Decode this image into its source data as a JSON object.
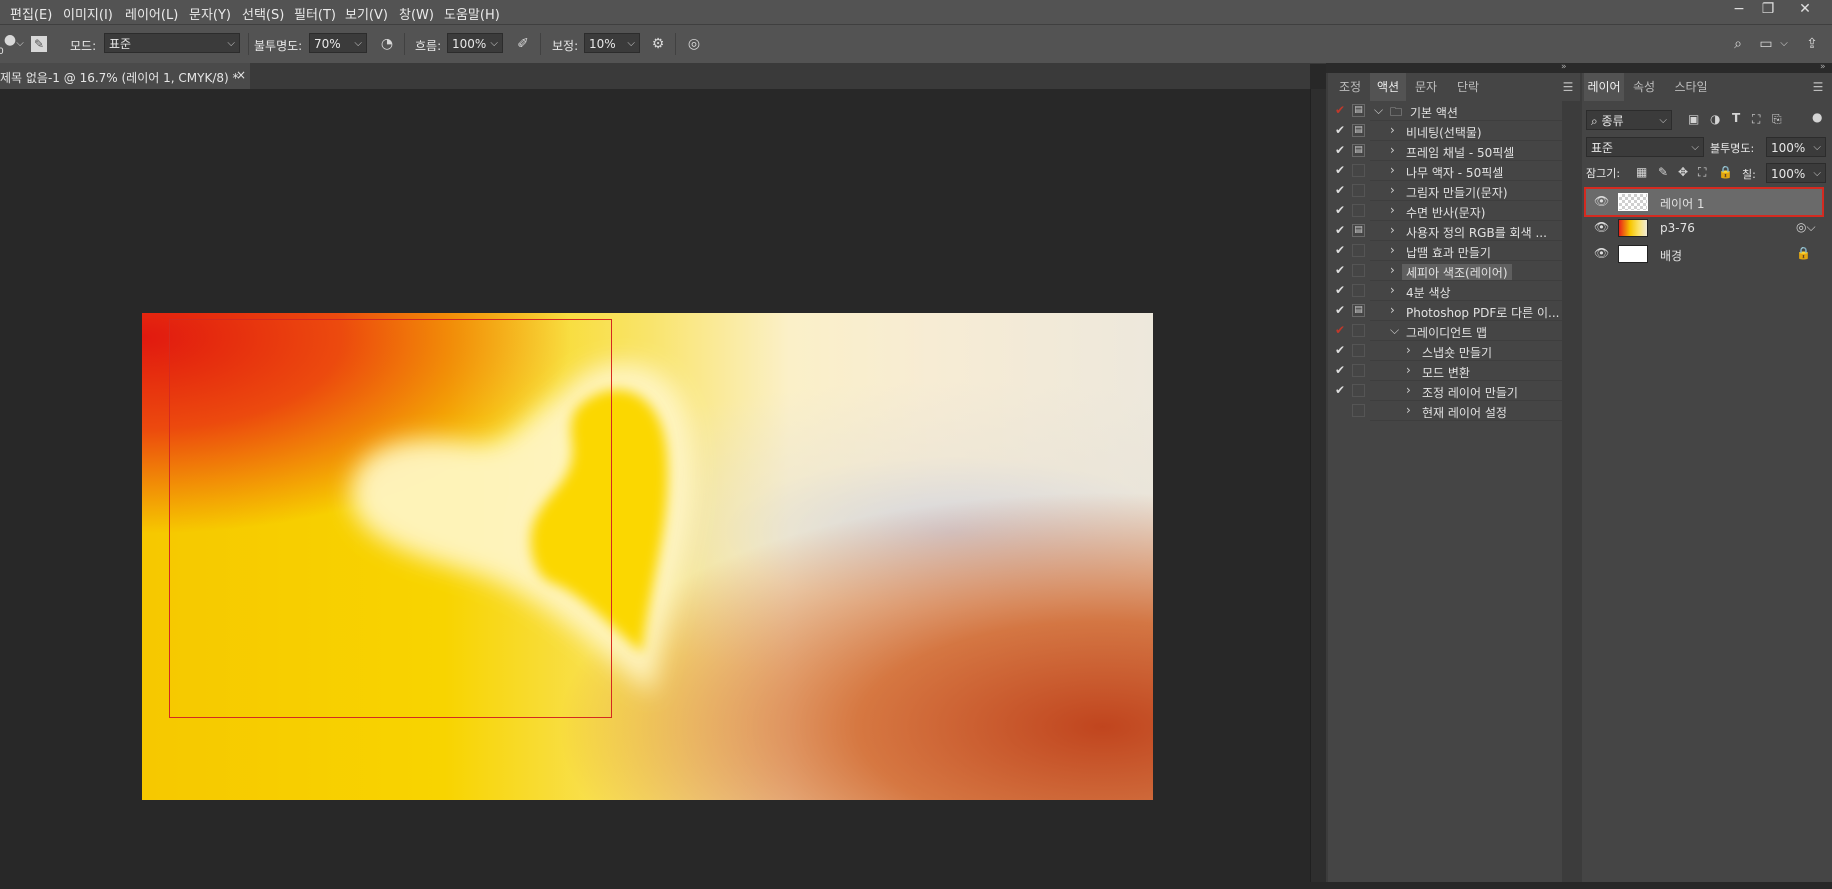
{
  "menu": {
    "items": [
      "편집(E)",
      "이미지(I)",
      "레이어(L)",
      "문자(Y)",
      "선택(S)",
      "필터(T)",
      "보기(V)",
      "창(W)",
      "도움말(H)"
    ]
  },
  "window_controls": {
    "minimize": "−",
    "restore": "❐",
    "close": "✕"
  },
  "options": {
    "size_label": "0",
    "mode_label": "모드:",
    "mode_value": "표준",
    "opacity_label": "불투명도:",
    "opacity_value": "70%",
    "flow_label": "흐름:",
    "flow_value": "100%",
    "smoothing_label": "보정:",
    "smoothing_value": "10%"
  },
  "document": {
    "tab_title": "제목 없음-1 @ 16.7% (레이어 1, CMYK/8) *",
    "close": "×"
  },
  "actions_panel": {
    "tabs": [
      "조정",
      "액션",
      "문자",
      "단락"
    ],
    "active_tab": "액션",
    "rows": [
      {
        "label": "기본 액션",
        "check": "✔",
        "check_red": true,
        "dialog": true,
        "twirl": "⌵",
        "folder": true,
        "indent": 0
      },
      {
        "label": "비네팅(선택물)",
        "check": "✔",
        "check_red": false,
        "dialog": true,
        "twirl": "›",
        "folder": false,
        "indent": 1
      },
      {
        "label": "프레임 채널 - 50픽셀",
        "check": "✔",
        "check_red": false,
        "dialog": true,
        "twirl": "›",
        "folder": false,
        "indent": 1
      },
      {
        "label": "나무 액자 - 50픽셀",
        "check": "✔",
        "check_red": false,
        "dialog": false,
        "twirl": "›",
        "folder": false,
        "indent": 1
      },
      {
        "label": "그림자 만들기(문자)",
        "check": "✔",
        "check_red": false,
        "dialog": false,
        "twirl": "›",
        "folder": false,
        "indent": 1
      },
      {
        "label": "수면 반사(문자)",
        "check": "✔",
        "check_red": false,
        "dialog": false,
        "twirl": "›",
        "folder": false,
        "indent": 1
      },
      {
        "label": "사용자 정의 RGB를 회색 ...",
        "check": "✔",
        "check_red": false,
        "dialog": true,
        "twirl": "›",
        "folder": false,
        "indent": 1
      },
      {
        "label": "납땜 효과 만들기",
        "check": "✔",
        "check_red": false,
        "dialog": false,
        "twirl": "›",
        "folder": false,
        "indent": 1
      },
      {
        "label": "세피아 색조(레이어)",
        "check": "✔",
        "check_red": false,
        "dialog": false,
        "twirl": "›",
        "folder": false,
        "indent": 1,
        "selected": true
      },
      {
        "label": "4분 색상",
        "check": "✔",
        "check_red": false,
        "dialog": false,
        "twirl": "›",
        "folder": false,
        "indent": 1
      },
      {
        "label": "Photoshop PDF로 다른 이...",
        "check": "✔",
        "check_red": false,
        "dialog": true,
        "twirl": "›",
        "folder": false,
        "indent": 1
      },
      {
        "label": "그레이디언트 맵",
        "check": "✔",
        "check_red": true,
        "dialog": false,
        "twirl": "⌵",
        "folder": false,
        "indent": 1
      },
      {
        "label": "스냅숏 만들기",
        "check": "✔",
        "check_red": false,
        "dialog": false,
        "twirl": "›",
        "folder": false,
        "indent": 2
      },
      {
        "label": "모드 변환",
        "check": "✔",
        "check_red": false,
        "dialog": false,
        "twirl": "›",
        "folder": false,
        "indent": 2
      },
      {
        "label": "조정 레이어 만들기",
        "check": "✔",
        "check_red": false,
        "dialog": false,
        "twirl": "›",
        "folder": false,
        "indent": 2
      },
      {
        "label": "현재 레이어 설정",
        "check": "",
        "check_red": false,
        "dialog": false,
        "twirl": "›",
        "folder": false,
        "indent": 2
      }
    ]
  },
  "layers_panel": {
    "tabs": [
      "레이어",
      "속성",
      "스타일"
    ],
    "active_tab": "레이어",
    "filter_label": "⌕ 종류",
    "blend_mode": "표준",
    "opacity_label": "불투명도:",
    "opacity_value": "100%",
    "lock_label": "잠그기:",
    "fill_label": "칠:",
    "fill_value": "100%",
    "layers": [
      {
        "name": "레이어 1",
        "thumb": "transparent",
        "selected": true
      },
      {
        "name": "p3-76",
        "thumb": "image",
        "selected": false
      },
      {
        "name": "배경",
        "thumb": "white",
        "selected": false
      }
    ]
  },
  "colors": {
    "accent_highlight": "#d42a20",
    "check_red": "#c0392b",
    "panel_bg": "#454545",
    "toolbar_bg": "#535353"
  }
}
